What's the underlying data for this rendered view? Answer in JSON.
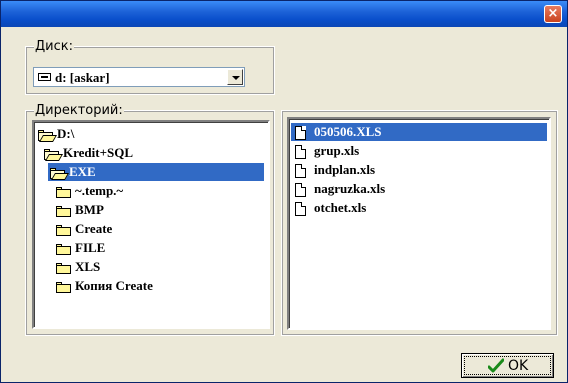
{
  "window": {
    "title": "",
    "close_symbol": "×"
  },
  "disk": {
    "label": "Диск:",
    "selected": "d: [askar]",
    "icon": "drive-icon"
  },
  "directory": {
    "label": "Директорий:",
    "items": [
      {
        "name": "D:\\",
        "icon": "open-folder-icon",
        "selected": false
      },
      {
        "name": "Kredit+SQL",
        "icon": "open-folder-icon",
        "selected": false
      },
      {
        "name": "EXE",
        "icon": "open-folder-icon",
        "selected": true
      },
      {
        "name": "~.temp.~",
        "icon": "folder-icon",
        "selected": false
      },
      {
        "name": "BMP",
        "icon": "folder-icon",
        "selected": false
      },
      {
        "name": "Create",
        "icon": "folder-icon",
        "selected": false
      },
      {
        "name": "FILE",
        "icon": "folder-icon",
        "selected": false
      },
      {
        "name": "XLS",
        "icon": "folder-icon",
        "selected": false
      },
      {
        "name": "Копия Create",
        "icon": "folder-icon",
        "selected": false
      }
    ]
  },
  "files": {
    "items": [
      {
        "name": "050506.XLS",
        "icon": "file-icon",
        "selected": true
      },
      {
        "name": "grup.xls",
        "icon": "file-icon",
        "selected": false
      },
      {
        "name": "indplan.xls",
        "icon": "file-icon",
        "selected": false
      },
      {
        "name": "nagruzka.xls",
        "icon": "file-icon",
        "selected": false
      },
      {
        "name": "otchet.xls",
        "icon": "file-icon",
        "selected": false
      }
    ]
  },
  "ok_button": {
    "label": "OK",
    "icon": "checkmark-icon"
  },
  "colors": {
    "selection": "#316ac5",
    "titlebar": "#0a4fcc",
    "check": "#1a8a1a"
  }
}
